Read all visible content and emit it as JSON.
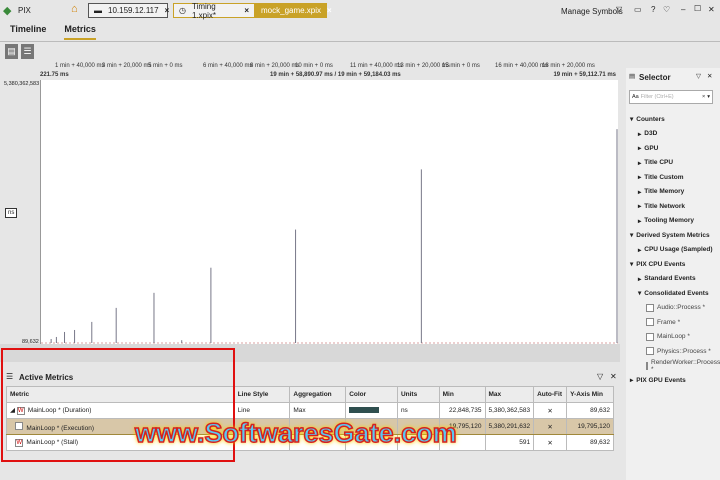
{
  "app": {
    "title": "PIX",
    "tabs": [
      {
        "label": "10.159.12.117"
      },
      {
        "label": "Timing 1.xpix*"
      },
      {
        "label": "mock_game.xpix"
      }
    ],
    "manage_symbols": "Manage Symbols",
    "accent": "#c9a227"
  },
  "nav": {
    "items": [
      "Timeline",
      "Metrics"
    ],
    "active": "Metrics"
  },
  "ruler": {
    "start": "221.75 ms",
    "mid": "19 min + 58,890.97 ms / 19 min + 59,184.03 ms",
    "end": "19 min + 59,112.71 ms",
    "ticks": [
      "1 min + 40,000 ms",
      "3 min + 20,000 ms",
      "5 min + 0 ms",
      "6 min + 40,000 ms",
      "8 min + 20,000 ms",
      "10 min + 0 ms",
      "11 min + 40,000 ms",
      "13 min + 20,000 ms",
      "15 min + 0 ms",
      "16 min + 40,000 ms",
      "18 min + 20,000 ms"
    ]
  },
  "chart_data": {
    "type": "bar",
    "ylabel": "ns",
    "ylim": [
      89632,
      5380362583
    ],
    "ymax_label": "5,380,362,583",
    "ymin_label": "89,632",
    "x_unit": "s",
    "xlim": [
      0,
      1200
    ],
    "spikes": [
      {
        "x": 17,
        "y": 85000000
      },
      {
        "x": 28,
        "y": 128000000
      },
      {
        "x": 45,
        "y": 234000000
      },
      {
        "x": 66,
        "y": 276000000
      },
      {
        "x": 102,
        "y": 447000000
      },
      {
        "x": 153,
        "y": 744000000
      },
      {
        "x": 232,
        "y": 1063000000
      },
      {
        "x": 290,
        "y": 60000000
      },
      {
        "x": 351,
        "y": 1595000000
      },
      {
        "x": 528,
        "y": 2403000000
      },
      {
        "x": 791,
        "y": 3679000000
      },
      {
        "x": 1200,
        "y": 4530000000
      }
    ]
  },
  "active_metrics": {
    "title": "Active Metrics",
    "columns": [
      "Metric",
      "Line Style",
      "Aggregation",
      "Color",
      "Units",
      "Min",
      "Max",
      "Auto-Fit",
      "Y-Axis Min"
    ],
    "rows": [
      {
        "metric": "MainLoop * (Duration)",
        "line_style": "Line",
        "aggregation": "Max",
        "units": "ns",
        "min": "22,848,735",
        "max": "5,380,362,583",
        "autofit": "✕",
        "ymin": "89,632"
      },
      {
        "metric": "MainLoop * (Execution)",
        "line_style": "",
        "aggregation": "",
        "units": "",
        "min": "19,795,120",
        "max": "5,380,291,632",
        "autofit": "✕",
        "ymin": "19,795,120"
      },
      {
        "metric": "MainLoop * (Stall)",
        "line_style": "",
        "aggregation": "",
        "units": "",
        "min": "",
        "max": "591",
        "autofit": "✕",
        "ymin": "89,632"
      }
    ]
  },
  "selector": {
    "title": "Selector",
    "filter_placeholder": "Filter (Ctrl+E)",
    "items": [
      {
        "label": "Counters",
        "lvl": 0,
        "open": true
      },
      {
        "label": "D3D",
        "lvl": 1
      },
      {
        "label": "GPU",
        "lvl": 1
      },
      {
        "label": "Title CPU",
        "lvl": 1
      },
      {
        "label": "Title Custom",
        "lvl": 1
      },
      {
        "label": "Title Memory",
        "lvl": 1
      },
      {
        "label": "Title Network",
        "lvl": 1
      },
      {
        "label": "Tooling Memory",
        "lvl": 1
      },
      {
        "label": "Derived System Metrics",
        "lvl": 0,
        "open": true
      },
      {
        "label": "CPU Usage (Sampled)",
        "lvl": 1
      },
      {
        "label": "PIX CPU Events",
        "lvl": 0,
        "open": true
      },
      {
        "label": "Standard Events",
        "lvl": 1
      },
      {
        "label": "Consolidated Events",
        "lvl": 1,
        "open": true
      },
      {
        "label": "Audio::Process *",
        "lvl": 2,
        "cb": true
      },
      {
        "label": "Frame *",
        "lvl": 2,
        "cb": true
      },
      {
        "label": "MainLoop *",
        "lvl": 2,
        "cb": true
      },
      {
        "label": "Physics::Process *",
        "lvl": 2,
        "cb": true
      },
      {
        "label": "RenderWorker::Process *",
        "lvl": 2,
        "cb": true
      },
      {
        "label": "PIX GPU Events",
        "lvl": 0
      }
    ]
  },
  "watermark": "www.SoftwaresGate.com"
}
